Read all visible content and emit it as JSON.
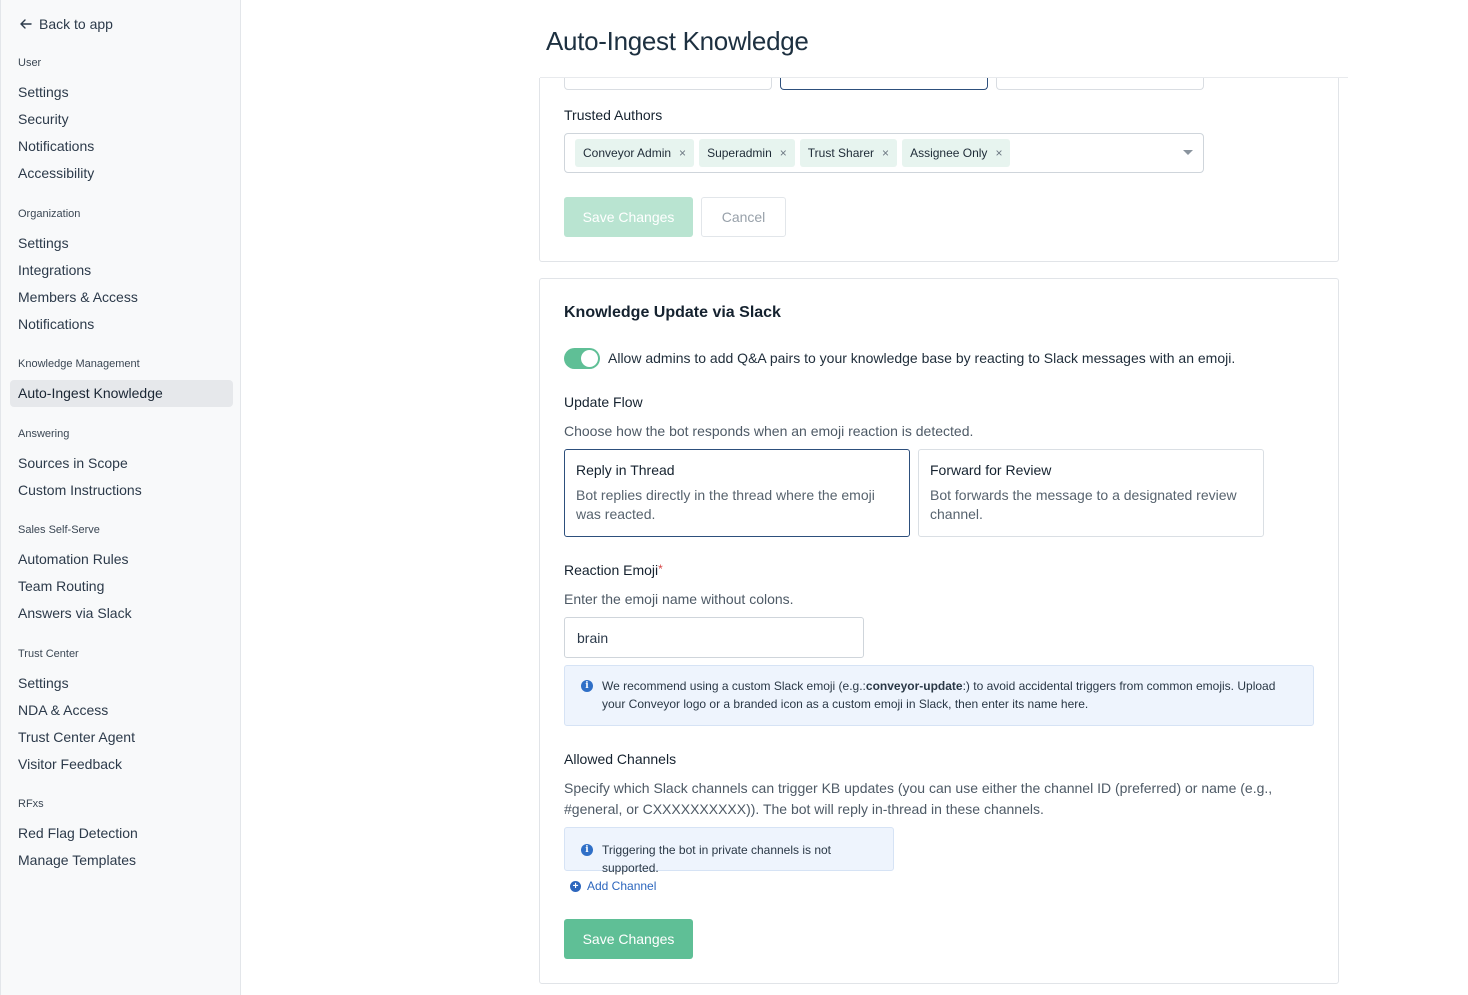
{
  "sidebar": {
    "back_label": "Back to app",
    "groups": [
      {
        "title": "User",
        "items": [
          "Settings",
          "Security",
          "Notifications",
          "Accessibility"
        ]
      },
      {
        "title": "Organization",
        "items": [
          "Settings",
          "Integrations",
          "Members & Access",
          "Notifications"
        ]
      },
      {
        "title": "Knowledge Management",
        "items": [
          "Auto-Ingest Knowledge"
        ]
      },
      {
        "title": "Answering",
        "items": [
          "Sources in Scope",
          "Custom Instructions"
        ]
      },
      {
        "title": "Sales Self-Serve",
        "items": [
          "Automation Rules",
          "Team Routing",
          "Answers via Slack"
        ]
      },
      {
        "title": "Trust Center",
        "items": [
          "Settings",
          "NDA & Access",
          "Trust Center Agent",
          "Visitor Feedback"
        ]
      },
      {
        "title": "RFxs",
        "items": [
          "Red Flag Detection",
          "Manage Templates"
        ]
      }
    ],
    "active_item": "Auto-Ingest Knowledge"
  },
  "page": {
    "title": "Auto-Ingest Knowledge"
  },
  "trusted_authors": {
    "label": "Trusted Authors",
    "tags": [
      "Conveyor Admin",
      "Superadmin",
      "Trust Sharer",
      "Assignee Only"
    ],
    "remove_glyph": "×",
    "save_label": "Save Changes",
    "cancel_label": "Cancel"
  },
  "slack": {
    "title": "Knowledge Update via Slack",
    "toggle_on": true,
    "toggle_label": "Allow admins to add Q&A pairs to your knowledge base by reacting to Slack messages with an emoji.",
    "update_flow": {
      "label": "Update Flow",
      "description": "Choose how the bot responds when an emoji reaction is detected.",
      "options": [
        {
          "title": "Reply in Thread",
          "description": "Bot replies directly in the thread where the emoji was reacted.",
          "selected": true
        },
        {
          "title": "Forward for Review",
          "description": "Bot forwards the message to a designated review channel.",
          "selected": false
        }
      ]
    },
    "reaction_emoji": {
      "label": "Reaction Emoji",
      "required_mark": "*",
      "description": "Enter the emoji name without colons.",
      "value": "brain",
      "info_prefix": "We recommend using a custom Slack emoji (e.g.:",
      "info_bold": "conveyor-update",
      "info_suffix": ":) to avoid accidental triggers from common emojis. Upload your Conveyor logo or a branded icon as a custom emoji in Slack, then enter its name here."
    },
    "allowed_channels": {
      "label": "Allowed Channels",
      "description": "Specify which Slack channels can trigger KB updates (you can use either the channel ID (preferred) or name (e.g., #general, or CXXXXXXXXXX)). The bot will reply in-thread in these channels.",
      "info": "Triggering the bot in private channels is not supported.",
      "add_label": "Add Channel"
    },
    "save_label": "Save Changes"
  },
  "colors": {
    "accent": "#5fbf96",
    "accent_disabled": "#b9e4d1",
    "info_bg": "#eef4fd",
    "link": "#2c66bd",
    "selected_border": "#2d4f7c"
  },
  "icons": [
    "arrow-left-icon",
    "close-icon",
    "chevron-down-icon",
    "info-icon",
    "plus-circle-icon"
  ]
}
